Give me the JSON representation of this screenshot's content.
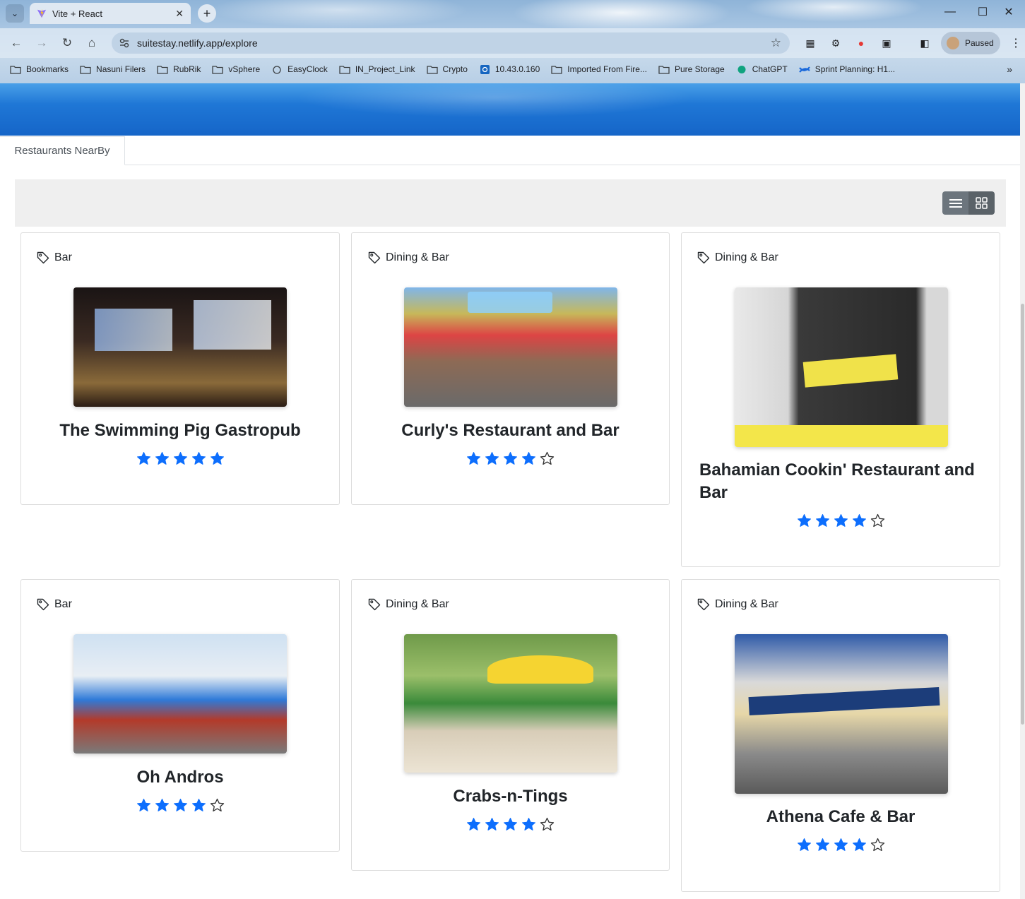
{
  "browser": {
    "tab_title": "Vite + React",
    "url": "suitestay.netlify.app/explore",
    "profile_status": "Paused",
    "bookmarks": [
      "Bookmarks",
      "Nasuni Filers",
      "RubRik",
      "vSphere",
      "EasyClock",
      "IN_Project_Link",
      "Crypto",
      "10.43.0.160",
      "Imported From Fire...",
      "Pure Storage",
      "ChatGPT",
      "Sprint Planning: H1..."
    ]
  },
  "page": {
    "active_tab": "Restaurants NearBy",
    "star_color": "#0d6efd",
    "restaurants": [
      {
        "category": "Bar",
        "name": "The Swimming Pig Gastropub",
        "rating": 5
      },
      {
        "category": "Dining & Bar",
        "name": "Curly's Restaurant and Bar",
        "rating": 4
      },
      {
        "category": "Dining & Bar",
        "name": "Bahamian Cookin' Restaurant and Bar",
        "rating": 4
      },
      {
        "category": "Bar",
        "name": "Oh Andros",
        "rating": 4
      },
      {
        "category": "Dining & Bar",
        "name": "Crabs-n-Tings",
        "rating": 4
      },
      {
        "category": "Dining & Bar",
        "name": "Athena Cafe & Bar",
        "rating": 4
      }
    ]
  }
}
